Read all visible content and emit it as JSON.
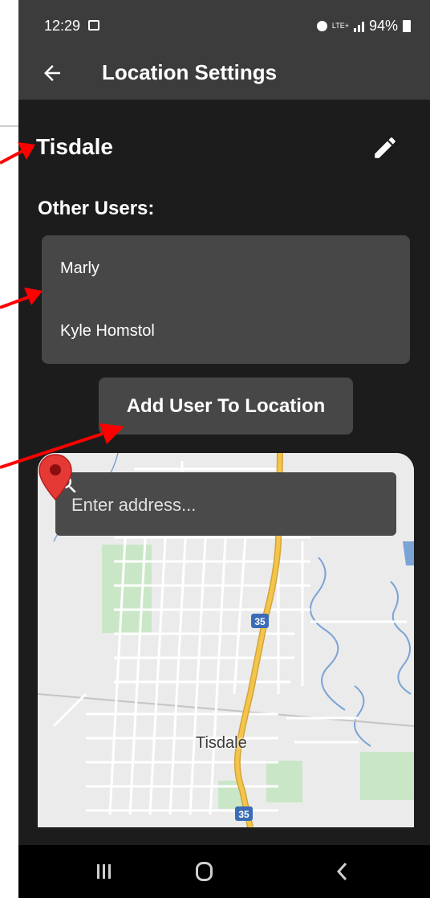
{
  "status_bar": {
    "time": "12:29",
    "network": "LTE+",
    "battery": "94%"
  },
  "app_bar": {
    "title": "Location Settings",
    "back_icon": "arrow-left-icon"
  },
  "location": {
    "name": "Tisdale",
    "edit_icon": "pencil-icon"
  },
  "other_users": {
    "heading": "Other Users:",
    "users": [
      "Marly",
      "Kyle Homstol"
    ]
  },
  "add_user_button": {
    "label": "Add User To Location"
  },
  "map": {
    "search": {
      "placeholder": "Enter address...",
      "icon": "search-icon"
    },
    "marker_label": "Tisdale",
    "highway_shield": "35"
  },
  "annotations": {
    "arrow_color": "#ff0000"
  },
  "colors": {
    "background": "#1c1c1c",
    "app_bar": "#3c3c3c",
    "card": "#474747",
    "highway": "#f4c54a",
    "pin": "#e53935",
    "park": "#c9e7c6",
    "water": "#7aa3d6"
  }
}
